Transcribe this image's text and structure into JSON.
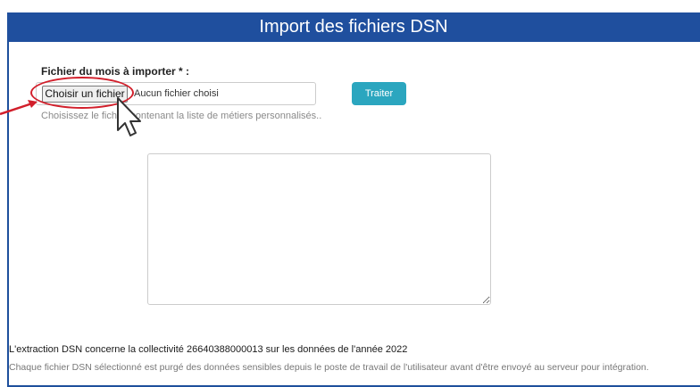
{
  "header": {
    "title": "Import des fichiers DSN"
  },
  "form": {
    "file_label": "Fichier du mois à importer * :",
    "choose_button": "Choisir un fichier",
    "no_file_text": "Aucun fichier choisi",
    "help_text": "Choisissez le fichier contenant la liste de métiers personnalisés..",
    "process_button": "Traiter",
    "textarea_value": ""
  },
  "footer": {
    "extraction_info": "L'extraction DSN concerne la collectivité 26640388000013 sur les données de l'année 2022",
    "disclaimer": "Chaque fichier DSN sélectionné est purgé des données sensibles depuis le poste de travail de l'utilisateur avant d'être envoyé au serveur pour intégration."
  },
  "colors": {
    "header_bg": "#1f4f9e",
    "process_button_bg": "#2ba6bf",
    "annotation_red": "#d21f2b"
  },
  "icons": {
    "cursor": "mouse-pointer-icon",
    "arrow": "red-arrow-icon"
  }
}
